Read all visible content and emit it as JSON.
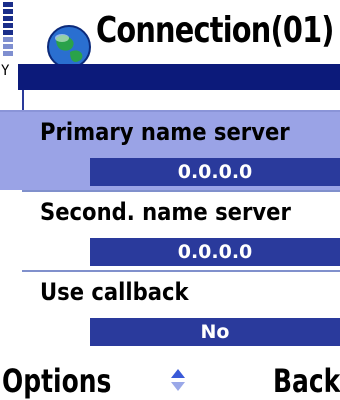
{
  "header": {
    "title": "Connection(01)",
    "icon": "globe-icon",
    "signal_icon": "signal-strength-icon",
    "antenna_icon": "antenna-icon",
    "antenna_glyph": "Y"
  },
  "settings": [
    {
      "label": "Primary name server",
      "value": "0.0.0.0",
      "selected": true
    },
    {
      "label": "Second. name server",
      "value": "0.0.0.0",
      "selected": false
    },
    {
      "label": "Use callback",
      "value": "No",
      "selected": false
    }
  ],
  "softkeys": {
    "left": "Options",
    "right": "Back",
    "scroll_icon": "up-down-arrows-icon"
  },
  "colors": {
    "navy": "#0c1a7a",
    "field": "#2a3a9c",
    "highlight": "#9aa3e6"
  }
}
